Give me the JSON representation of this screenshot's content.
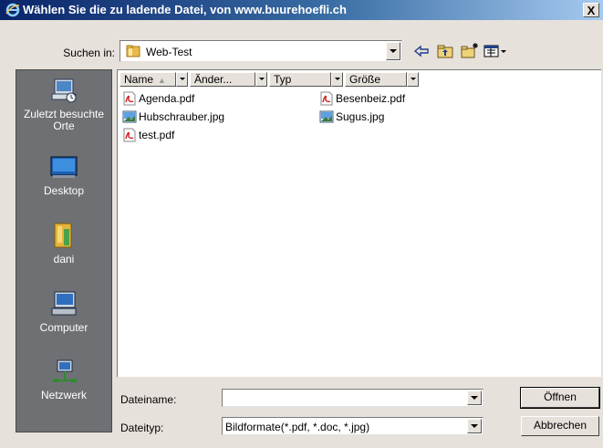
{
  "window": {
    "title": "Wählen Sie die zu ladende Datei, von www.buurehoefli.ch",
    "close_label": "X"
  },
  "lookin": {
    "label": "Suchen in:",
    "value": "Web-Test"
  },
  "toolbar": {
    "icons": [
      "back-arrow-icon",
      "up-folder-icon",
      "new-folder-icon",
      "view-menu-icon"
    ]
  },
  "places": [
    {
      "label": "Zuletzt besuchte Orte",
      "icon": "recent-places-icon"
    },
    {
      "label": "Desktop",
      "icon": "desktop-icon"
    },
    {
      "label": "dani",
      "icon": "user-folder-icon"
    },
    {
      "label": "Computer",
      "icon": "computer-icon"
    },
    {
      "label": "Netzwerk",
      "icon": "network-icon"
    }
  ],
  "columns": [
    "Name",
    "Änder...",
    "Typ",
    "Größe"
  ],
  "files": [
    {
      "name": "Agenda.pdf",
      "type": "pdf"
    },
    {
      "name": "Hubschrauber.jpg",
      "type": "jpg"
    },
    {
      "name": "test.pdf",
      "type": "pdf"
    },
    {
      "name": "Besenbeiz.pdf",
      "type": "pdf"
    },
    {
      "name": "Sugus.jpg",
      "type": "jpg"
    }
  ],
  "filename": {
    "label": "Dateiname:",
    "value": ""
  },
  "filetype": {
    "label": "Dateityp:",
    "value": "Bildformate(*.pdf, *.doc, *.jpg)"
  },
  "buttons": {
    "open": "Öffnen",
    "cancel": "Abbrechen"
  },
  "colors": {
    "title_bar_start": "#0a246a",
    "title_bar_end": "#a6caf0",
    "dialog_bg": "#e7e1dc",
    "places_bg": "#6f7074"
  }
}
